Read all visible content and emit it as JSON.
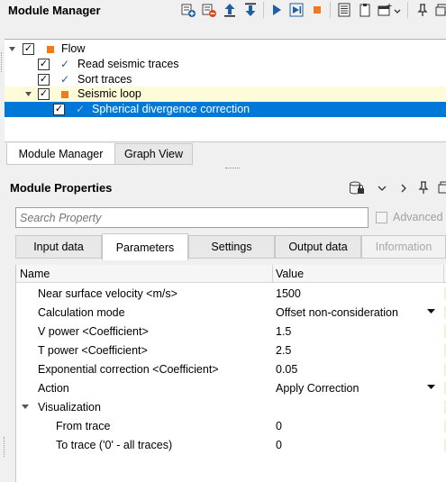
{
  "module_manager": {
    "title": "Module Manager",
    "tree": [
      {
        "label": "Flow",
        "checked": true,
        "expanded": true,
        "icon": "orange-square-icon"
      },
      {
        "label": "Read seismic traces",
        "checked": true,
        "icon": "checkmark-icon"
      },
      {
        "label": "Sort traces",
        "checked": true,
        "icon": "checkmark-icon"
      },
      {
        "label": "Seismic loop",
        "checked": true,
        "expanded": true,
        "icon": "orange-square-icon"
      },
      {
        "label": "Spherical divergence correction",
        "checked": true,
        "selected": true,
        "icon": "checkmark-icon"
      }
    ],
    "tabs": [
      "Module Manager",
      "Graph View"
    ],
    "active_tab": "Module Manager"
  },
  "module_properties": {
    "title": "Module Properties",
    "search_placeholder": "Search Property",
    "advanced_label": "Advanced",
    "tabs": [
      "Input data",
      "Parameters",
      "Settings",
      "Output data",
      "Information"
    ],
    "active_tab": "Parameters",
    "columns": {
      "name": "Name",
      "value": "Value"
    },
    "rows": [
      {
        "name": "Near surface velocity <m/s>",
        "value": "1500"
      },
      {
        "name": "Calculation mode",
        "value": "Offset non-consideration",
        "dropdown": true
      },
      {
        "name": "V power <Coefficient>",
        "value": "1.5"
      },
      {
        "name": "T power <Coefficient>",
        "value": "2.5"
      },
      {
        "name": "Exponential correction <Coefficient>",
        "value": "0.05"
      },
      {
        "name": "Action",
        "value": "Apply Correction",
        "dropdown": true
      },
      {
        "name": "Visualization",
        "value": "",
        "group": true
      },
      {
        "name": "From trace",
        "value": "0"
      },
      {
        "name": "To trace ('0' - all traces)",
        "value": "0"
      }
    ]
  },
  "colors": {
    "selection": "#0078d7",
    "highlight_row": "#fdfbd8",
    "accent_orange": "#f07a1f",
    "accent_blue": "#1f5fa8"
  }
}
